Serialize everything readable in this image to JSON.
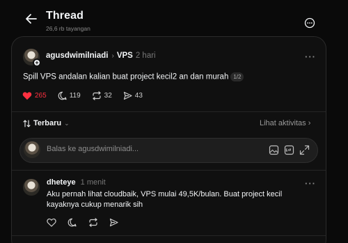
{
  "header": {
    "title": "Thread",
    "subtitle": "26,6 rb tayangan"
  },
  "post": {
    "username": "agusdwimilniadi",
    "topic": "VPS",
    "time": "2 hari",
    "text": "Spill VPS andalan kalian buat project kecil2 an dan murah",
    "page_badge": "1/2",
    "likes": "265",
    "comments": "119",
    "reposts": "32",
    "shares": "43",
    "liked": true
  },
  "sort": {
    "label": "Terbaru",
    "activity_label": "Lihat aktivitas"
  },
  "reply_box": {
    "placeholder": "Balas ke agusdwimilniadi..."
  },
  "comments": [
    {
      "username": "dheteye",
      "time": "1 menit",
      "text": "Aku pernah lihat cloudbaik, VPS mulai 49,5K/bulan. Buat project kecil kayaknya cukup menarik sih"
    }
  ],
  "colors": {
    "background": "#0a0a0a",
    "panel": "#101010",
    "like": "#ff3040",
    "text": "#f3f5f7",
    "muted": "#8a8a8a"
  },
  "icons": [
    "back-arrow-icon",
    "more-circle-icon",
    "heart-icon",
    "comment-icon",
    "repost-icon",
    "share-icon",
    "sort-icon",
    "image-icon",
    "gif-icon",
    "expand-icon"
  ]
}
